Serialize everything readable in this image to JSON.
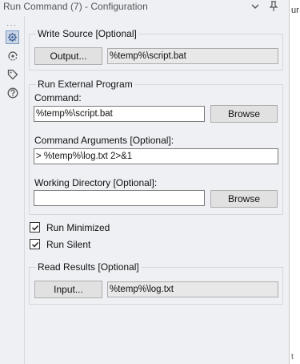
{
  "window": {
    "title": "Run Command (7) - Configuration",
    "icons": [
      "chevron-down-icon",
      "pin-icon"
    ]
  },
  "toolbar": {
    "dots": "···",
    "icons": [
      "gear-icon",
      "connection-icon",
      "tag-icon",
      "help-icon"
    ]
  },
  "write_source": {
    "legend": "Write Source [Optional]",
    "button": "Output...",
    "value": "%temp%\\script.bat"
  },
  "run_external": {
    "legend": "Run External Program",
    "command_label": "Command:",
    "command_value": "%temp%\\script.bat",
    "browse_label": "Browse",
    "args_label": "Command Arguments [Optional]:",
    "args_value": "> %temp%\\log.txt 2>&1",
    "workdir_label": "Working Directory [Optional]:",
    "workdir_value": "",
    "workdir_browse_label": "Browse"
  },
  "options": [
    {
      "label": "Run Minimized",
      "checked": true
    },
    {
      "label": "Run Silent",
      "checked": true
    }
  ],
  "read_results": {
    "legend": "Read Results [Optional]",
    "button": "Input...",
    "value": "%temp%\\log.txt"
  },
  "right_strip": {
    "top_fragment": "ur",
    "bottom_fragment": "t"
  }
}
